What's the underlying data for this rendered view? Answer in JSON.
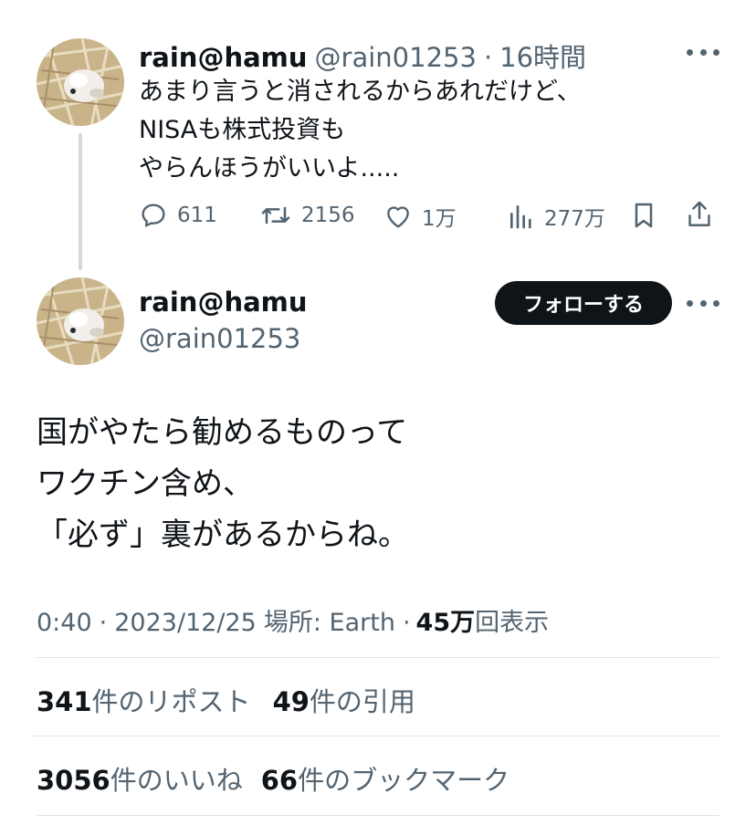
{
  "reply_tweet": {
    "display_name": "rain@hamu",
    "handle": "@rain01253",
    "separator": "·",
    "time_ago": "16時間",
    "text_lines": [
      "あまり言うと消されるからあれだけど、",
      "NISAも株式投資も",
      "やらんほうがいいよ....."
    ],
    "actions": {
      "replies": "611",
      "retweets": "2156",
      "likes": "1万",
      "views": "277万"
    }
  },
  "main_tweet": {
    "display_name": "rain@hamu",
    "handle": "@rain01253",
    "follow_label": "フォローする",
    "text_lines": [
      "国がやたら勧めるものって",
      "ワクチン含め、",
      "「必ず」裏があるからね。"
    ],
    "meta": {
      "time": "0:40",
      "sep1": "·",
      "date": "2023/12/25",
      "location_label": "場所: Earth",
      "sep2": "·",
      "views_count": "45万",
      "views_suffix": "回表示"
    },
    "stats": {
      "reposts_count": "341",
      "reposts_label": "件のリポスト",
      "quotes_count": "49",
      "quotes_label": "件の引用",
      "likes_count": "3056",
      "likes_label": "件のいいね",
      "bookmarks_count": "66",
      "bookmarks_label": "件のブックマーク"
    }
  },
  "colors": {
    "text_primary": "#0f1419",
    "text_secondary": "#536471",
    "divider": "#e1e6ea",
    "follow_bg": "#0f1419",
    "thread_line": "#cfd9de"
  },
  "icons": {
    "reply": "reply-icon",
    "retweet": "retweet-icon",
    "like": "heart-icon",
    "views": "views-icon",
    "bookmark": "bookmark-icon",
    "share": "share-icon",
    "more": "more-icon"
  }
}
